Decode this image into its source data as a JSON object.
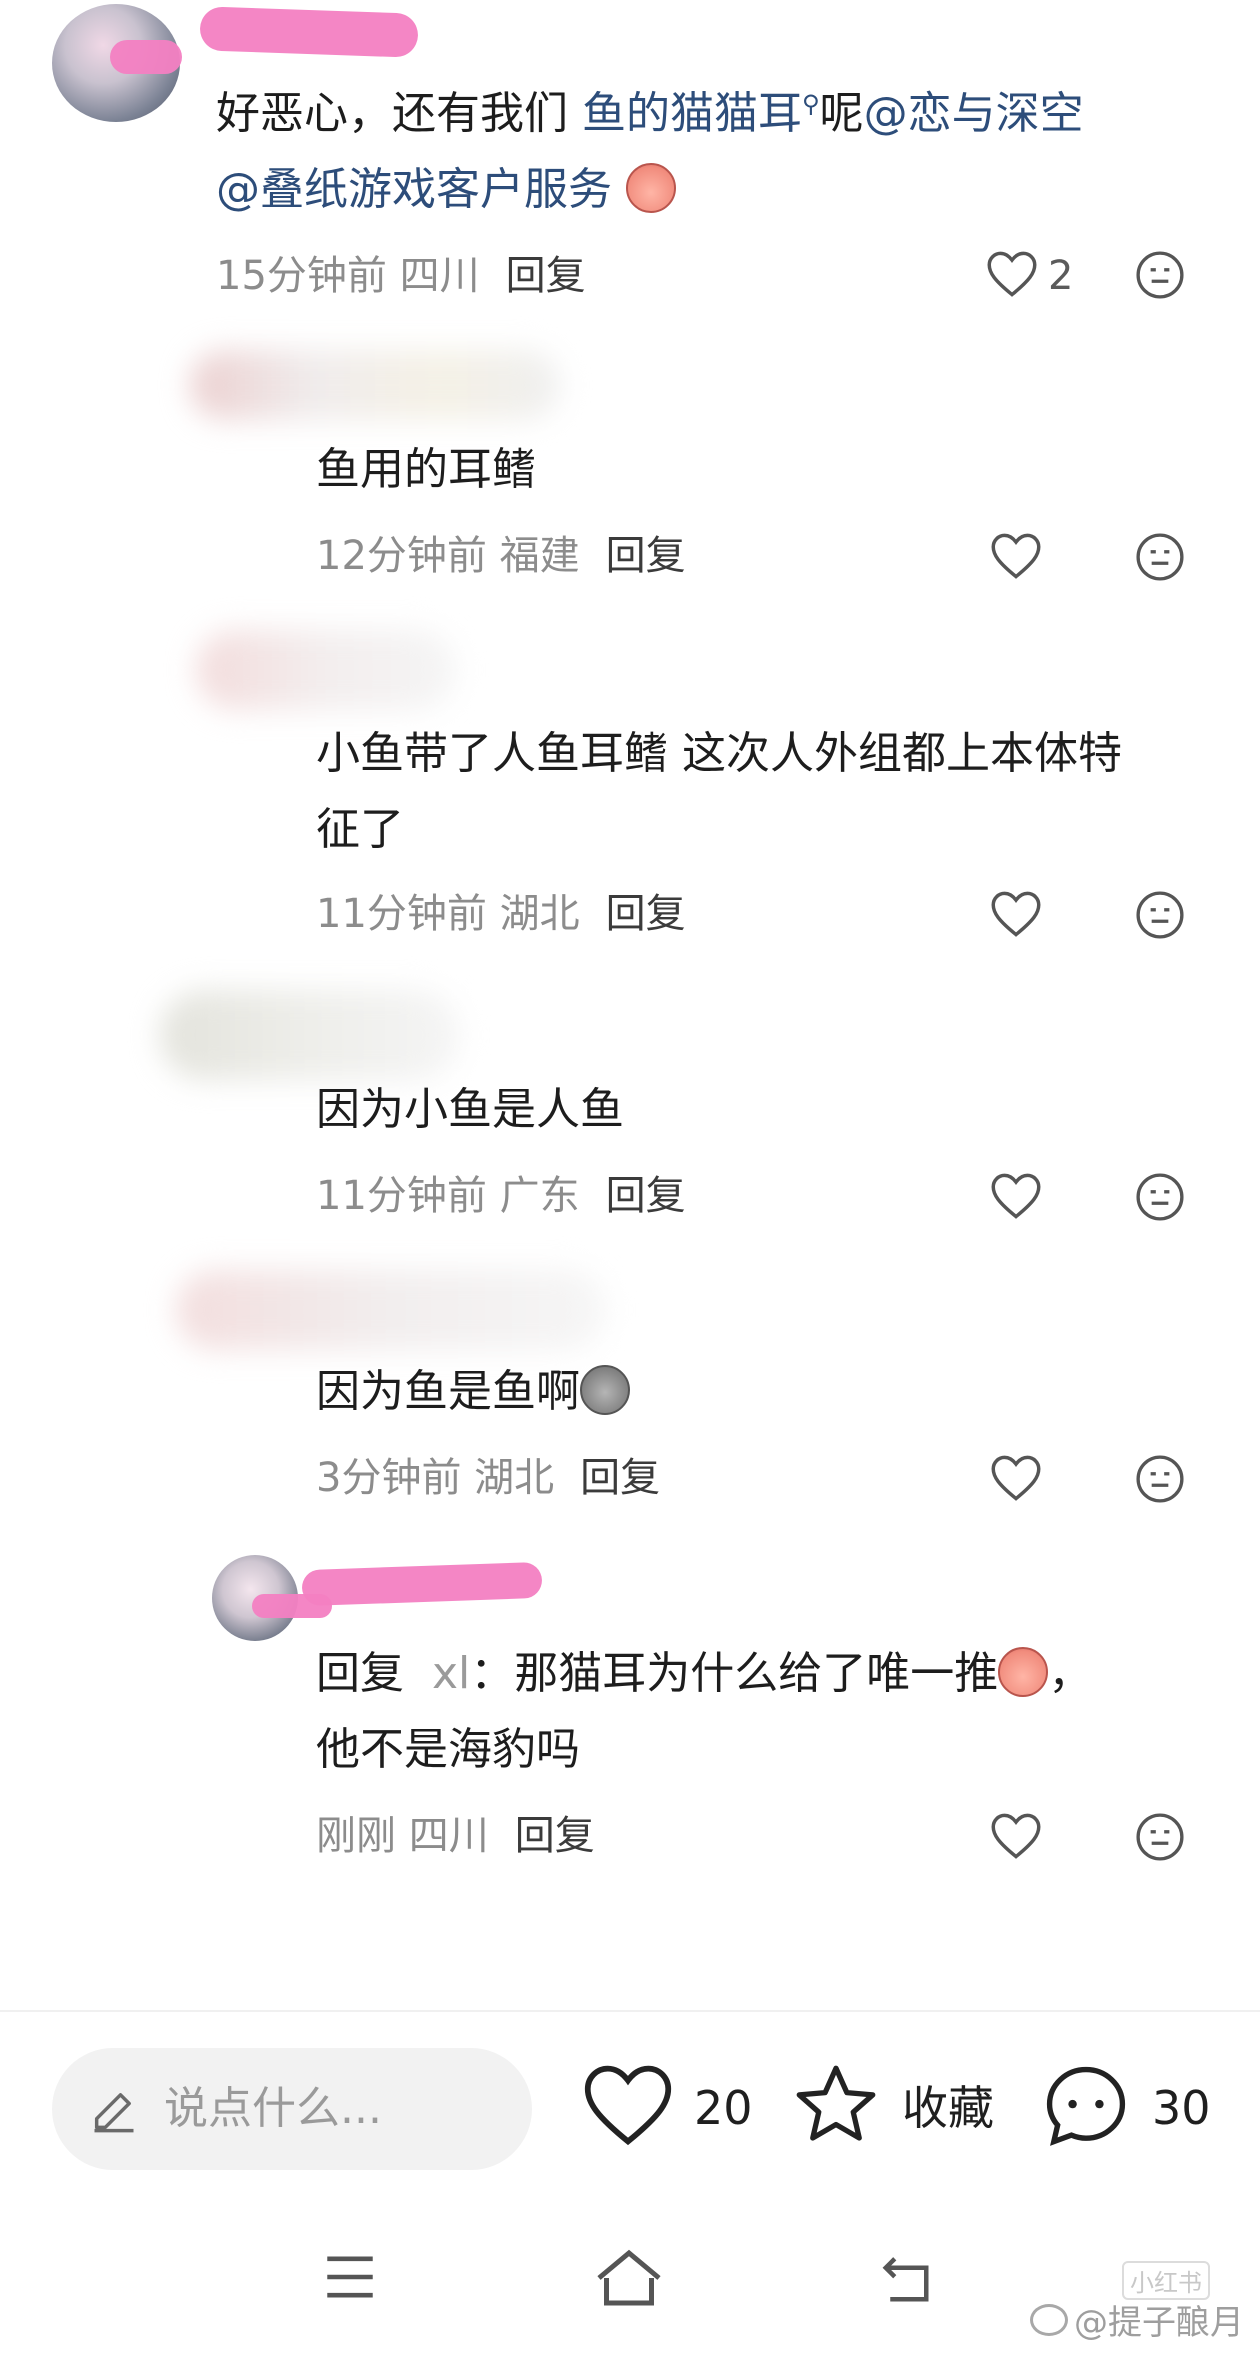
{
  "colors": {
    "mention": "#2d4d7a",
    "redaction": "#f37fc2",
    "meta": "#8c8c8c"
  },
  "comment_main": {
    "text_part1": "好恶心，还有我们",
    "link_text": "鱼的猫猫耳",
    "link_icon": "search-icon",
    "text_part2": "呢",
    "mention1": "@恋与深空",
    "mention2": "@叠纸游戏客户服务",
    "emoji": "peach-sweat-emoji",
    "time": "15分钟前",
    "location": "四川",
    "reply_label": "回复",
    "likes": "2"
  },
  "replies": [
    {
      "text": "鱼用的耳鳍",
      "time": "12分钟前",
      "location": "福建",
      "reply_label": "回复"
    },
    {
      "text_line1": "小鱼带了人鱼耳鳍 这次人外组都上本体特",
      "text_line2": "征了",
      "time": "11分钟前",
      "location": "湖北",
      "reply_label": "回复"
    },
    {
      "text": "因为小鱼是人鱼",
      "time": "11分钟前",
      "location": "广东",
      "reply_label": "回复"
    },
    {
      "text": "因为鱼是鱼啊",
      "emoji": "grey-bag-emoji",
      "time": "3分钟前",
      "location": "湖北",
      "reply_label": "回复"
    },
    {
      "prefix": "回复",
      "target": "xl",
      "colon": "：",
      "text_line1": "那猫耳为什么给了唯一推",
      "text_line1_end": "，",
      "text_line2": "他不是海豹吗",
      "emoji": "peach-sweat-emoji",
      "time": "刚刚",
      "location": "四川",
      "reply_label": "回复"
    }
  ],
  "bottom_bar": {
    "input_placeholder": "说点什么...",
    "like_count": "20",
    "collect_label": "收藏",
    "comment_count": "30"
  },
  "watermark": {
    "text": "@提子酿月",
    "stamp": "小红书"
  }
}
